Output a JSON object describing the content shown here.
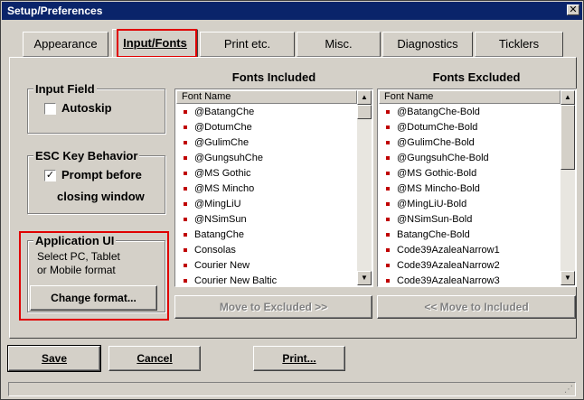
{
  "window": {
    "title": "Setup/Preferences",
    "close_glyph": "✕"
  },
  "tabs": [
    {
      "label": "Appearance"
    },
    {
      "label": "Input/Fonts"
    },
    {
      "label": "Print etc."
    },
    {
      "label": "Misc."
    },
    {
      "label": "Diagnostics"
    },
    {
      "label": "Ticklers"
    }
  ],
  "input_field": {
    "title": "Input Field",
    "autoskip_label": "Autoskip",
    "autoskip_checked": false
  },
  "esc_behavior": {
    "title": "ESC Key Behavior",
    "prompt_line1": "Prompt before",
    "prompt_line2": "closing window",
    "prompt_checked": true,
    "check_glyph": "✓"
  },
  "application_ui": {
    "title": "Application UI",
    "line1": "Select PC, Tablet",
    "line2": "or Mobile format",
    "button_label": "Change format..."
  },
  "fonts_included": {
    "heading": "Fonts Included",
    "column": "Font Name",
    "items": [
      "@BatangChe",
      "@DotumChe",
      "@GulimChe",
      "@GungsuhChe",
      "@MS Gothic",
      "@MS Mincho",
      "@MingLiU",
      "@NSimSun",
      "BatangChe",
      "Consolas",
      "Courier New",
      "Courier New Baltic"
    ],
    "move_button": "Move to Excluded >>"
  },
  "fonts_excluded": {
    "heading": "Fonts Excluded",
    "column": "Font Name",
    "items": [
      "@BatangChe-Bold",
      "@DotumChe-Bold",
      "@GulimChe-Bold",
      "@GungsuhChe-Bold",
      "@MS Gothic-Bold",
      "@MS Mincho-Bold",
      "@MingLiU-Bold",
      "@NSimSun-Bold",
      "BatangChe-Bold",
      "Code39AzaleaNarrow1",
      "Code39AzaleaNarrow2",
      "Code39AzaleaNarrow3"
    ],
    "move_button": "<< Move to Included"
  },
  "footer": {
    "save": "Save",
    "cancel": "Cancel",
    "print": "Print..."
  },
  "colors": {
    "highlight": "#e00000",
    "bullet": "#c00000",
    "titlebar": "#0a246a"
  },
  "icons": {
    "scroll_up": "▲",
    "scroll_down": "▼",
    "close": "close-icon"
  }
}
